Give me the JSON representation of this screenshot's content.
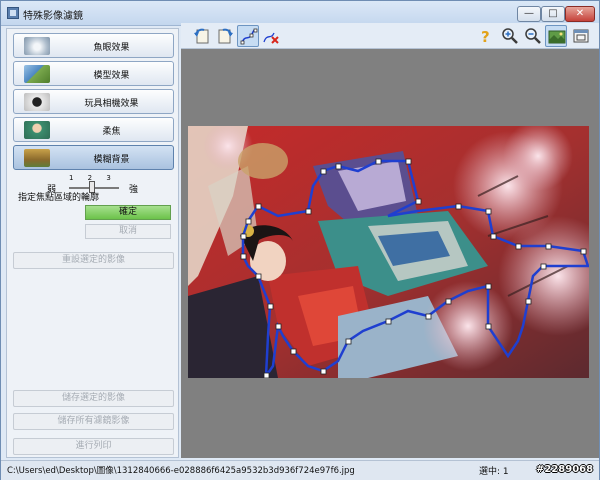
{
  "window": {
    "title": "特殊影像濾鏡",
    "min_glyph": "—",
    "max_glyph": "□",
    "close_glyph": "✕"
  },
  "effects": [
    {
      "label": "魚眼效果",
      "icon": "fisheye-icon"
    },
    {
      "label": "模型效果",
      "icon": "miniature-icon"
    },
    {
      "label": "玩具相機效果",
      "icon": "toy-camera-icon"
    },
    {
      "label": "柔焦",
      "icon": "soft-focus-icon"
    },
    {
      "label": "模糊背景",
      "icon": "blur-background-icon",
      "active": true
    }
  ],
  "slider": {
    "weak_label": "弱",
    "strong_label": "強",
    "ticks": "1 2 3",
    "value": 2
  },
  "instruction": "指定焦點區域的輪廓",
  "buttons": {
    "confirm": "確定",
    "cancel": "取消",
    "reset": "重設選定的影像",
    "save_selected": "儲存選定的影像",
    "save_all": "儲存所有濾鏡影像",
    "print": "進行列印"
  },
  "toolbar": {
    "items": [
      "rotate-left-icon",
      "rotate-right-icon",
      "draw-outline-icon",
      "delete-outline-icon",
      "help-icon",
      "zoom-in-icon",
      "zoom-out-icon",
      "fit-image-icon",
      "full-view-icon"
    ]
  },
  "status": {
    "path": "C:\\Users\\ed\\Desktop\\圖像\\1312840666-e028886f6425a9532b3d936f724e97f6.jpg",
    "selected": "選中: 1",
    "watermark": "#2289068"
  },
  "colors": {
    "accent": "#1f3fd0",
    "confirm_green": "#6cc24a"
  }
}
